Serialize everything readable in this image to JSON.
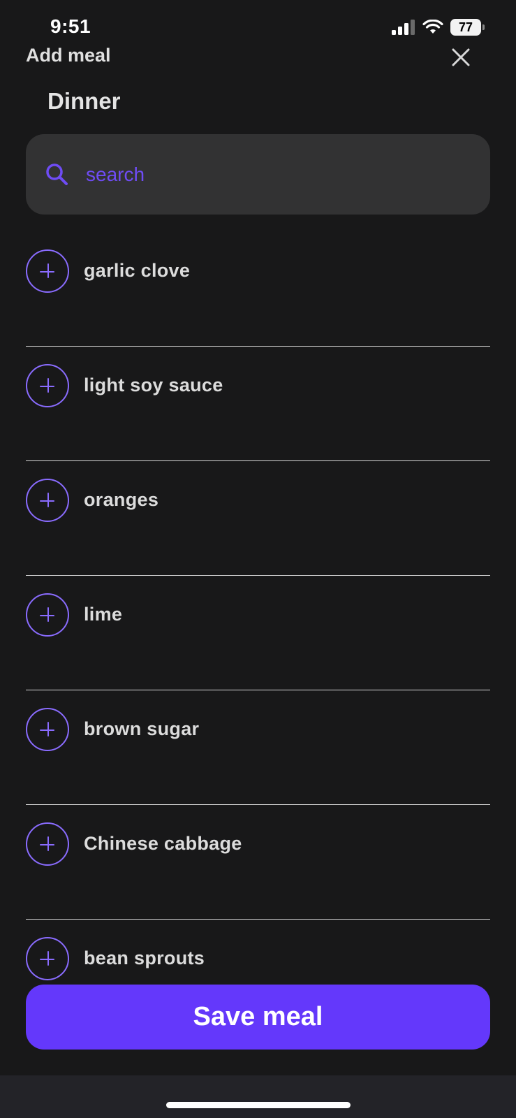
{
  "status_bar": {
    "time": "9:51",
    "battery": "77",
    "icons": [
      "signal-icon",
      "wifi-icon",
      "battery-icon"
    ]
  },
  "header": {
    "title": "Add meal",
    "close_icon": "close-icon"
  },
  "meal": {
    "title": "Dinner"
  },
  "search": {
    "placeholder": "search",
    "icon": "search-icon"
  },
  "items": [
    {
      "label": "garlic clove"
    },
    {
      "label": "light soy sauce"
    },
    {
      "label": "oranges"
    },
    {
      "label": "lime"
    },
    {
      "label": "brown sugar"
    },
    {
      "label": "Chinese cabbage"
    },
    {
      "label": "bean sprouts"
    }
  ],
  "save_button": {
    "label": "Save meal"
  },
  "colors": {
    "background": "#181819",
    "accent": "#6438fb",
    "accent_light": "#8a6cff",
    "search_bg": "#323233",
    "text": "#dcdcdc"
  }
}
